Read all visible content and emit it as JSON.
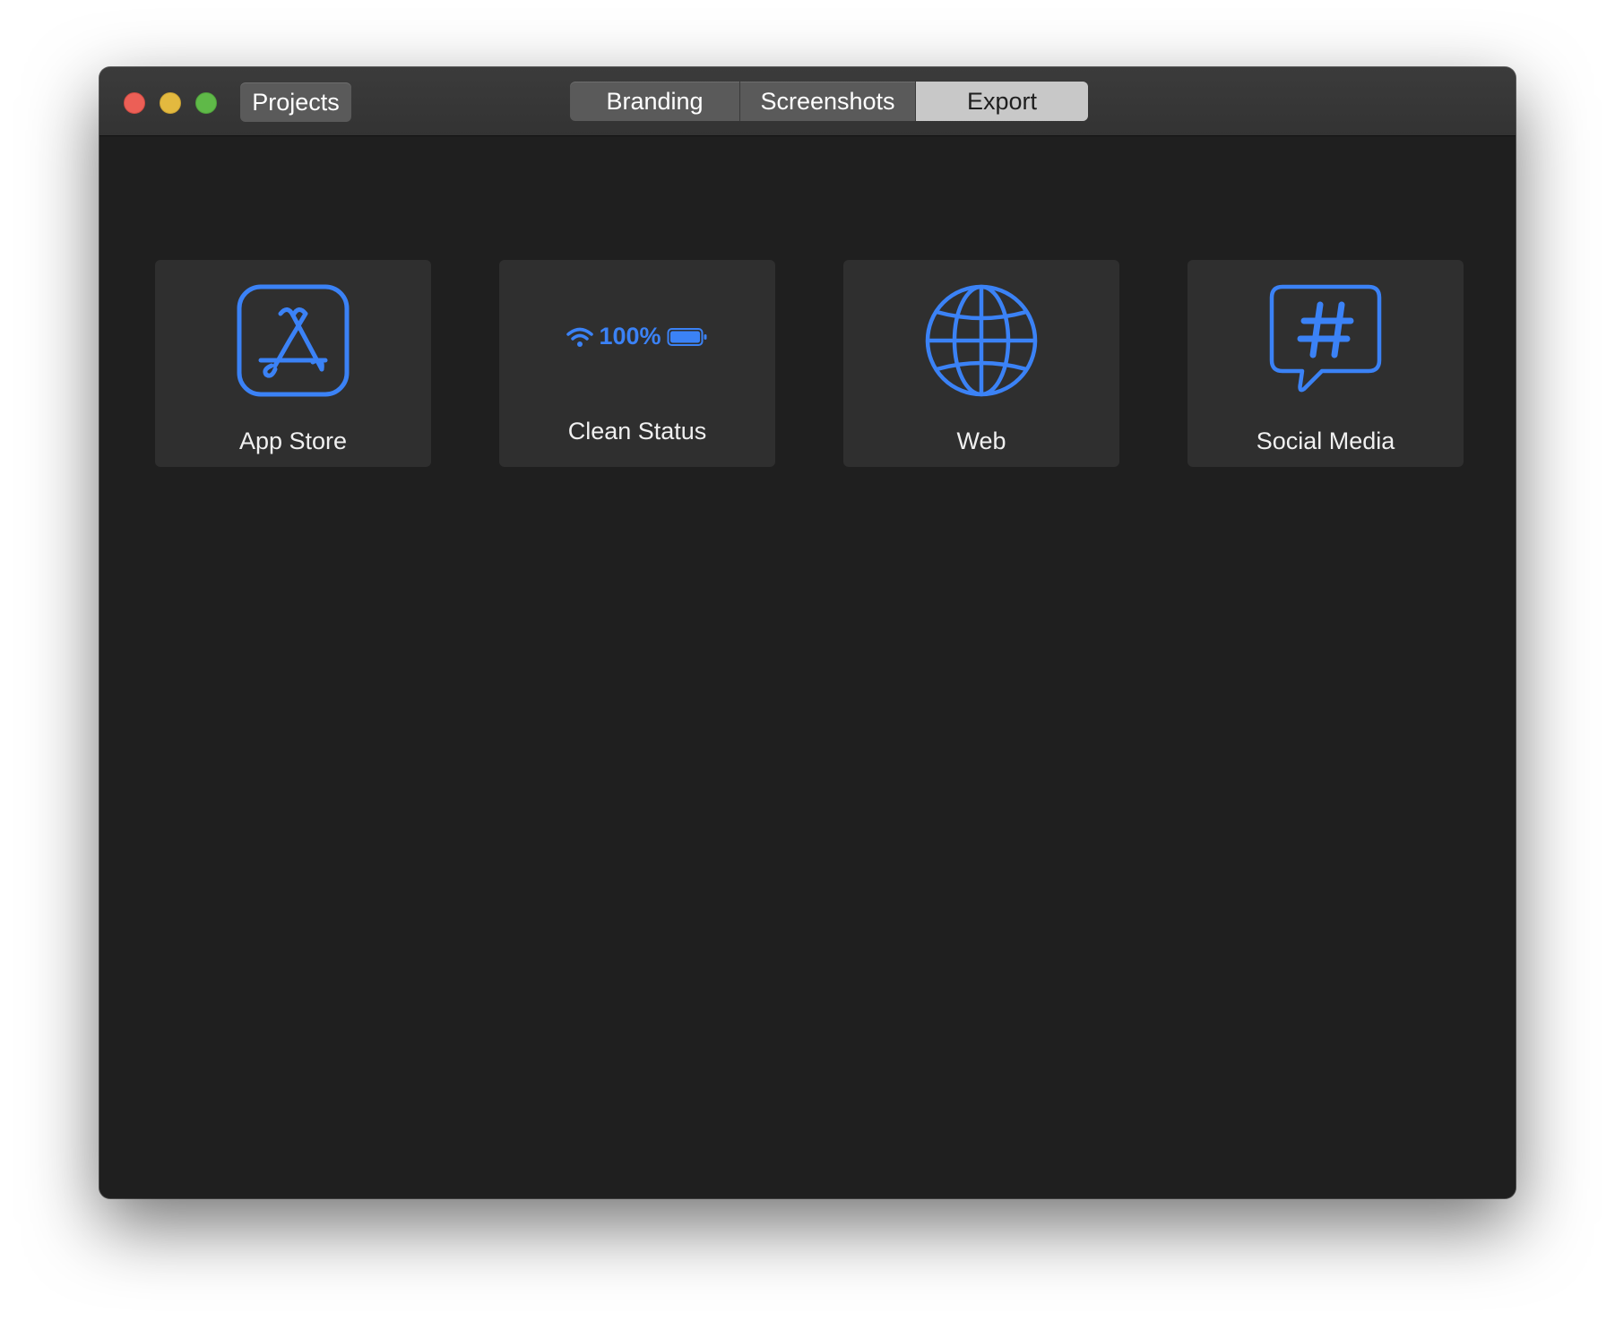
{
  "window": {
    "traffic_lights": [
      "close",
      "minimize",
      "maximize"
    ]
  },
  "toolbar": {
    "projects_label": "Projects",
    "tabs": [
      {
        "label": "Branding",
        "selected": false
      },
      {
        "label": "Screenshots",
        "selected": false
      },
      {
        "label": "Export",
        "selected": true
      }
    ]
  },
  "colors": {
    "accent": "#3b82f6",
    "background": "#1f1f1f",
    "card": "#2f2f2f"
  },
  "export_options": [
    {
      "label": "App Store",
      "icon": "app-store-icon"
    },
    {
      "label": "Clean Status",
      "icon": "status-bar-icon",
      "battery_text": "100%"
    },
    {
      "label": "Web",
      "icon": "globe-icon"
    },
    {
      "label": "Social Media",
      "icon": "hashtag-bubble-icon"
    }
  ]
}
